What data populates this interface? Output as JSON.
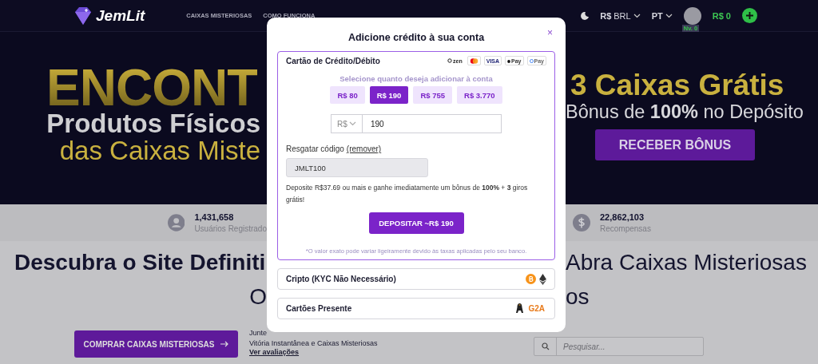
{
  "nav": {
    "brand": "JemLit",
    "links": [
      "CAIXAS MISTERIOSAS",
      "COMO FUNCIONA"
    ],
    "currency": {
      "symbol": "R$",
      "code": "BRL"
    },
    "language": "PT",
    "level_badge": "Nv. 0",
    "balance": "R$ 0"
  },
  "hero": {
    "left": {
      "headline": "ENCONT",
      "line_1": "Produtos Físicos",
      "line_2": "das Caixas Miste"
    },
    "right": {
      "headline": "3 Caixas Grátis",
      "subline": "Bônus de **100%** no Depósito",
      "button": "RECEBER BÔNUS"
    }
  },
  "stats": [
    {
      "kind": "users",
      "value": "1,431,658",
      "label": "Usuários Registrado"
    },
    {
      "kind": "rewards",
      "value": "22,862,103",
      "label": "Recompensas"
    }
  ],
  "heading": {
    "line_1_left": "Descubra o Site Definiti",
    "line_1_right": "Abra Caixas Misteriosas",
    "line_2_left": "O",
    "line_2_right": "os"
  },
  "cta": {
    "button": "COMPRAR CAIXAS MISTERIOSAS",
    "text_1": "Junte",
    "text_2": "Vitória Instantânea e Caixas Misteriosas",
    "link": "Ver avaliações",
    "search_placeholder": "Pesquisar..."
  },
  "modal": {
    "title": "Adicione crédito à sua conta",
    "close": "×",
    "methods": [
      {
        "kind": "card",
        "title": "Cartão de Crédito/Débito",
        "expanded": true,
        "logos": [
          {
            "kind": "zen",
            "label": "zen"
          },
          {
            "kind": "mastercard"
          },
          {
            "kind": "visa",
            "label": "VISA"
          },
          {
            "kind": "applepay",
            "label": "Pay"
          },
          {
            "kind": "googlepay",
            "label": "Pay"
          }
        ],
        "prompt": "Selecione quanto deseja adicionar à conta",
        "amounts": [
          {
            "label": "R$ 80",
            "selected": false
          },
          {
            "label": "R$ 190",
            "selected": true
          },
          {
            "label": "R$ 755",
            "selected": false
          },
          {
            "label": "R$ 3.770",
            "selected": false
          }
        ],
        "currency": "R$",
        "amount": "190",
        "redeem_label": "Resgatar código",
        "redeem_link": "(remover)",
        "code": "JMLT100",
        "bonus_text": "Deposite R$37.69 ou mais e ganhe imediatamente um bônus de **100%** + **3** giros grátis!",
        "deposit_button": "DEPOSITAR ~R$ 190",
        "note": "*O valor exato pode variar ligeiramente devido às taxas aplicadas pelo seu banco."
      },
      {
        "kind": "crypto",
        "title": "Cripto (KYC Não Necessário)",
        "expanded": false,
        "logos": [
          {
            "kind": "bitcoin"
          },
          {
            "kind": "ethereum"
          }
        ]
      },
      {
        "kind": "giftcard",
        "title": "Cartões Presente",
        "expanded": false,
        "logos": [
          {
            "kind": "penguin"
          },
          {
            "kind": "g2a",
            "label": "G2A"
          }
        ]
      }
    ]
  }
}
